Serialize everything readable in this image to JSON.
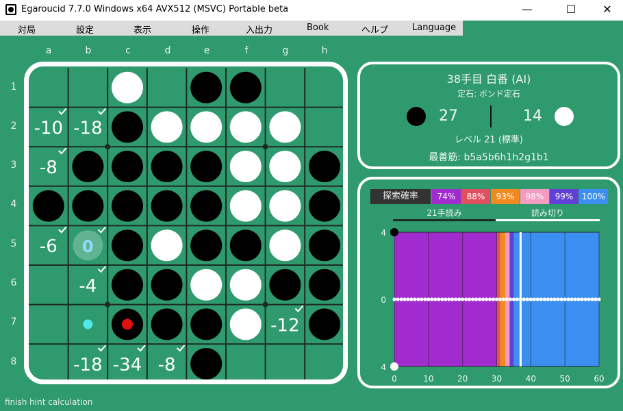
{
  "window": {
    "title": "Egaroucid 7.7.0 Windows x64 AVX512 (MSVC) Portable beta",
    "minimize_label": "—",
    "maximize_label": "☐",
    "close_label": "✕"
  },
  "menu": [
    "対局",
    "設定",
    "表示",
    "操作",
    "入出力",
    "Book",
    "ヘルプ",
    "Language"
  ],
  "board": {
    "columns": [
      "a",
      "b",
      "c",
      "d",
      "e",
      "f",
      "g",
      "h"
    ],
    "rows": [
      "1",
      "2",
      "3",
      "4",
      "5",
      "6",
      "7",
      "8"
    ],
    "cells": [
      [
        ".",
        ".",
        "W",
        ".",
        "B",
        "B",
        ".",
        "."
      ],
      [
        ".",
        ".",
        "B",
        "W",
        "W",
        "W",
        "W",
        "."
      ],
      [
        ".",
        "B",
        "B",
        "B",
        "B",
        "W",
        "W",
        "B"
      ],
      [
        "B",
        "B",
        "B",
        "B",
        "B",
        "W",
        "W",
        "B"
      ],
      [
        ".",
        ".",
        "B",
        "W",
        "B",
        "B",
        "W",
        "B"
      ],
      [
        ".",
        ".",
        "B",
        "B",
        "W",
        "W",
        "B",
        "B"
      ],
      [
        ".",
        ".",
        "B",
        "B",
        "B",
        "W",
        ".",
        "B"
      ],
      [
        ".",
        ".",
        ".",
        ".",
        "B",
        ".",
        ".",
        "."
      ]
    ],
    "hints": [
      {
        "cell": "a2",
        "value": "-10"
      },
      {
        "cell": "b2",
        "value": "-18"
      },
      {
        "cell": "a3",
        "value": "-8"
      },
      {
        "cell": "a5",
        "value": "-6"
      },
      {
        "cell": "b5",
        "value": "0",
        "best": true
      },
      {
        "cell": "b6",
        "value": "-4"
      },
      {
        "cell": "g7",
        "value": "-12"
      },
      {
        "cell": "b8",
        "value": "-18"
      },
      {
        "cell": "c8",
        "value": "-34"
      },
      {
        "cell": "d8",
        "value": "-8"
      }
    ],
    "last_move": "c7",
    "marker": "b7",
    "colors": {
      "board": "#2e9a6e",
      "grid": "#1e2a24",
      "black": "#000000",
      "white": "#ffffff",
      "last_move": "#e01010",
      "marker": "#4fe8e8",
      "best_hint": "#8fdcff"
    }
  },
  "info": {
    "move_player": "38手目 白番 (AI)",
    "opening": "定石: ボンド定石",
    "black_count": "27",
    "white_count": "14",
    "level": "レベル 21 (標準)",
    "best_line": "最善筋: b5a5b6h1h2g1b1"
  },
  "graph": {
    "header_label": "探索確率",
    "legend": [
      {
        "label": "74%",
        "color": "#a22bcf"
      },
      {
        "label": "88%",
        "color": "#e0505f"
      },
      {
        "label": "93%",
        "color": "#f08a20"
      },
      {
        "label": "98%",
        "color": "#f39cc0"
      },
      {
        "label": "99%",
        "color": "#6040d8"
      },
      {
        "label": "100%",
        "color": "#3b8ff0"
      }
    ],
    "tab_left": "21手読み",
    "tab_right": "読み切り",
    "y_ticks": [
      "4",
      "0",
      "4"
    ],
    "x_ticks": [
      "0",
      "10",
      "20",
      "30",
      "40",
      "50",
      "60"
    ]
  },
  "chart_data": {
    "type": "line",
    "xlim": [
      0,
      60
    ],
    "ylim": [
      -4,
      4
    ],
    "x_ticks": [
      0,
      10,
      20,
      30,
      40,
      50,
      60
    ],
    "y_ticks": [
      4,
      0,
      -4
    ],
    "bands": [
      {
        "x0": 0,
        "x1": 30,
        "label": "74%",
        "color": "#a22bcf"
      },
      {
        "x0": 30,
        "x1": 31,
        "label": "88%",
        "color": "#e0505f"
      },
      {
        "x0": 31,
        "x1": 32.5,
        "label": "93%",
        "color": "#f08a20"
      },
      {
        "x0": 32.5,
        "x1": 33.8,
        "label": "98%",
        "color": "#f39cc0"
      },
      {
        "x0": 33.8,
        "x1": 35,
        "label": "99%",
        "color": "#6040d8"
      },
      {
        "x0": 35,
        "x1": 60,
        "label": "100%",
        "color": "#3b8ff0"
      }
    ],
    "current_move": 37,
    "series": [
      {
        "x": [
          0,
          1,
          2,
          3,
          4,
          5,
          6,
          7,
          8,
          9,
          10,
          11,
          12,
          13,
          14,
          15,
          16,
          17,
          18,
          19,
          20,
          21,
          22,
          23,
          24,
          25,
          26,
          27,
          28,
          29,
          30,
          31,
          32,
          33,
          34,
          35,
          36,
          37,
          38,
          39,
          40,
          41,
          42,
          43,
          44,
          45,
          46,
          47,
          48,
          49,
          50,
          51,
          52,
          53,
          54,
          55,
          56,
          57,
          58,
          59,
          60
        ],
        "y": [
          0,
          0,
          0,
          0,
          0,
          0,
          0,
          0,
          0,
          0,
          0,
          0,
          0,
          0,
          0,
          0,
          0,
          0,
          0,
          0,
          0,
          0,
          0,
          0,
          0,
          0,
          0,
          0,
          0,
          0,
          0,
          0,
          0,
          0,
          0,
          0,
          0,
          0,
          0,
          0,
          0,
          0,
          0,
          0,
          0,
          0,
          0,
          0,
          0,
          0,
          0,
          0,
          0,
          0,
          0,
          0,
          0,
          0,
          0,
          0,
          0
        ],
        "color": "#ffffff"
      }
    ]
  },
  "status": "finish hint calculation"
}
